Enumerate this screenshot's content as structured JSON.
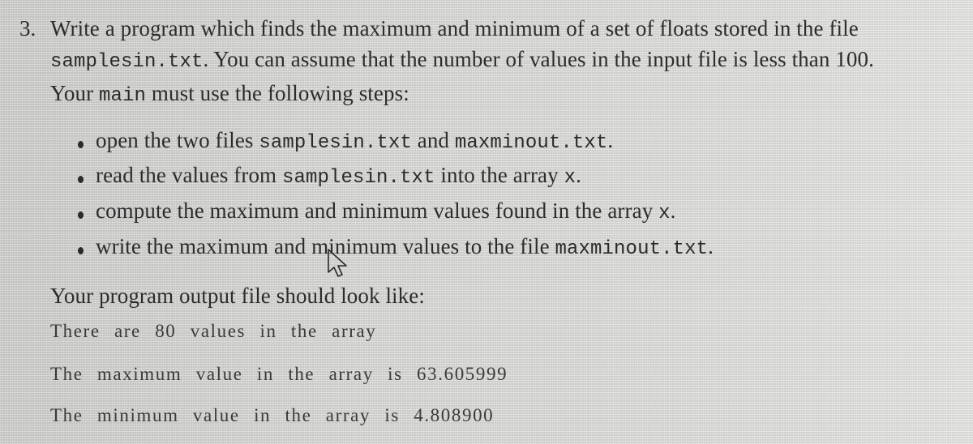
{
  "problem": {
    "number": "3.",
    "line1": "Write a program which finds the maximum and minimum of a set of floats stored in the file",
    "line2_code": "samplesin.txt",
    "line2_text": ". You can assume that the number of values in the input file is less than 100.",
    "steps_intro_pre": "Your ",
    "steps_intro_code": "main",
    "steps_intro_post": " must use the following steps:"
  },
  "steps": [
    {
      "parts": [
        {
          "text": "open the two files ",
          "code": false
        },
        {
          "text": "samplesin.txt",
          "code": true
        },
        {
          "text": " and ",
          "code": false
        },
        {
          "text": "maxminout.txt",
          "code": true
        },
        {
          "text": ".",
          "code": false
        }
      ]
    },
    {
      "parts": [
        {
          "text": "read the values from ",
          "code": false
        },
        {
          "text": "samplesin.txt",
          "code": true
        },
        {
          "text": " into the array ",
          "code": false
        },
        {
          "text": "x",
          "code": true
        },
        {
          "text": ".",
          "code": false
        }
      ]
    },
    {
      "parts": [
        {
          "text": "compute the maximum and minimum values found in the array ",
          "code": false
        },
        {
          "text": "x",
          "code": true
        },
        {
          "text": ".",
          "code": false
        }
      ]
    },
    {
      "parts": [
        {
          "text": "write the maximum and minimum values to the file ",
          "code": false
        },
        {
          "text": "maxminout.txt",
          "code": true
        },
        {
          "text": ".",
          "code": false
        }
      ]
    }
  ],
  "output_section": {
    "heading": "Your program output file should look like:",
    "lines": [
      "There are 80 values in the array",
      "The maximum value in the array is 63.605999",
      "The minimum value in the array is 4.808900"
    ]
  },
  "cursor": {
    "icon": "mouse-pointer-icon"
  }
}
